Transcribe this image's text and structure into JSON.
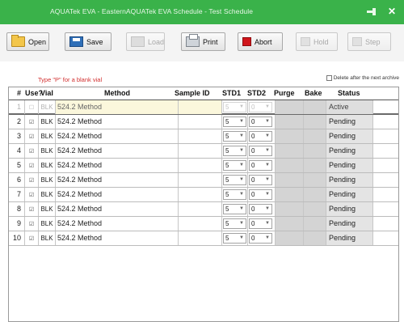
{
  "window": {
    "title": "AQUATek EVA - EasternAQUATek EVA Schedule - Test Schedule"
  },
  "toolbar": {
    "open": "Open",
    "save": "Save",
    "load": "Load",
    "print": "Print",
    "abort": "Abort",
    "hold": "Hold",
    "step": "Step"
  },
  "note": "Type \"P\" for a blank vial",
  "delete_option": "Delete after the next archive",
  "columns": {
    "num": "#",
    "use": "Use?",
    "vial": "Vial",
    "method": "Method",
    "sample_id": "Sample ID",
    "std1": "STD1",
    "std2": "STD2",
    "purge": "Purge",
    "bake": "Bake",
    "status": "Status"
  },
  "rows": [
    {
      "num": "1",
      "use": "☐",
      "vial": "BLK",
      "method": "524.2 Method",
      "sample_id": "",
      "std1": "5",
      "std2": "0",
      "purge": "",
      "bake": "",
      "status": "Active"
    },
    {
      "num": "2",
      "use": "☑",
      "vial": "BLK",
      "method": "524.2 Method",
      "sample_id": "",
      "std1": "5",
      "std2": "0",
      "purge": "",
      "bake": "",
      "status": "Pending"
    },
    {
      "num": "3",
      "use": "☑",
      "vial": "BLK",
      "method": "524.2 Method",
      "sample_id": "",
      "std1": "5",
      "std2": "0",
      "purge": "",
      "bake": "",
      "status": "Pending"
    },
    {
      "num": "4",
      "use": "☑",
      "vial": "BLK",
      "method": "524.2 Method",
      "sample_id": "",
      "std1": "5",
      "std2": "0",
      "purge": "",
      "bake": "",
      "status": "Pending"
    },
    {
      "num": "5",
      "use": "☑",
      "vial": "BLK",
      "method": "524.2 Method",
      "sample_id": "",
      "std1": "5",
      "std2": "0",
      "purge": "",
      "bake": "",
      "status": "Pending"
    },
    {
      "num": "6",
      "use": "☑",
      "vial": "BLK",
      "method": "524.2 Method",
      "sample_id": "",
      "std1": "5",
      "std2": "0",
      "purge": "",
      "bake": "",
      "status": "Pending"
    },
    {
      "num": "7",
      "use": "☑",
      "vial": "BLK",
      "method": "524.2 Method",
      "sample_id": "",
      "std1": "5",
      "std2": "0",
      "purge": "",
      "bake": "",
      "status": "Pending"
    },
    {
      "num": "8",
      "use": "☑",
      "vial": "BLK",
      "method": "524.2 Method",
      "sample_id": "",
      "std1": "5",
      "std2": "0",
      "purge": "",
      "bake": "",
      "status": "Pending"
    },
    {
      "num": "9",
      "use": "☑",
      "vial": "BLK",
      "method": "524.2 Method",
      "sample_id": "",
      "std1": "5",
      "std2": "0",
      "purge": "",
      "bake": "",
      "status": "Pending"
    },
    {
      "num": "10",
      "use": "☑",
      "vial": "BLK",
      "method": "524.2 Method",
      "sample_id": "",
      "std1": "5",
      "std2": "0",
      "purge": "",
      "bake": "",
      "status": "Pending"
    }
  ],
  "icons": {
    "open": "folder-open-icon",
    "save": "floppy-disk-icon",
    "load": "load-icon",
    "print": "printer-icon",
    "abort": "stop-icon",
    "hold": "pause-icon",
    "step": "step-icon",
    "pin": "pin-icon",
    "close": "close-icon"
  },
  "colors": {
    "titlebar": "#3ab24a",
    "abort": "#d0151b",
    "note": "#d23030",
    "active_row": "#fbf7dc"
  }
}
